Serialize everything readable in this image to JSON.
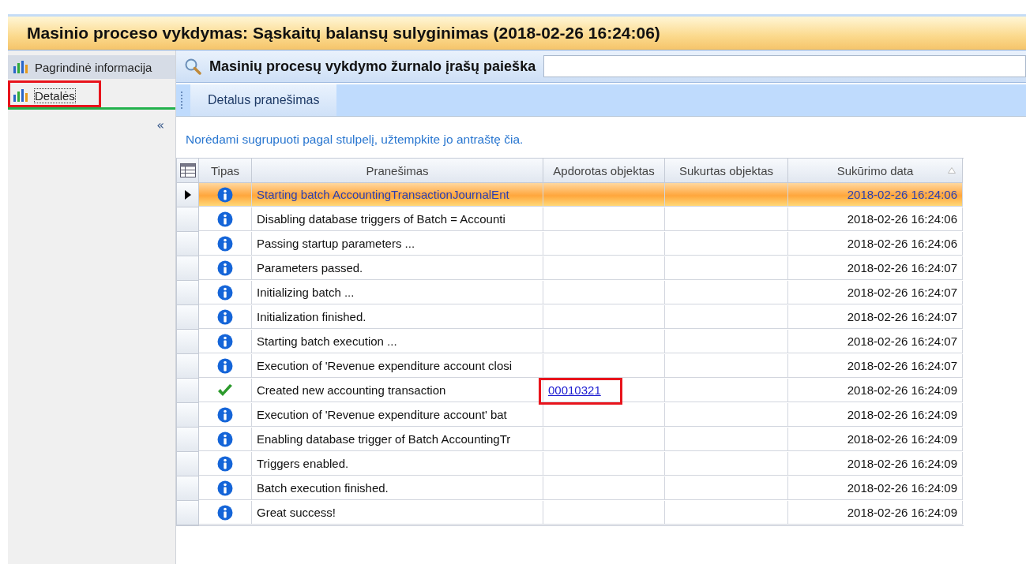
{
  "window": {
    "title": "Masinio proceso vykdymas: Sąskaitų balansų sulyginimas (2018-02-26 16:24:06)"
  },
  "sidebar": {
    "items": [
      {
        "label": "Pagrindinė informacija",
        "selected": false,
        "highlighted": false
      },
      {
        "label": "Detalės",
        "selected": true,
        "highlighted": true
      }
    ],
    "collapse": "«"
  },
  "search": {
    "title": "Masinių procesų vykdymo žurnalo įrašų paieška"
  },
  "toolbar": {
    "buttons": [
      "Detalus pranešimas"
    ]
  },
  "group_hint": "Norėdami sugrupuoti pagal stulpelį, užtempkite jo antraštę čia.",
  "table": {
    "columns": [
      {
        "label": "Tipas",
        "sorted": false
      },
      {
        "label": "Pranešimas",
        "sorted": false
      },
      {
        "label": "Apdorotas objektas",
        "sorted": false
      },
      {
        "label": "Sukurtas objektas",
        "sorted": false
      },
      {
        "label": "Sukūrimo data",
        "sorted": true
      }
    ],
    "rows": [
      {
        "kind": "info",
        "message": "Starting batch AccountingTransactionJournalEnt",
        "date": "2018-02-26 16:24:06",
        "selected": true
      },
      {
        "kind": "info",
        "message": "Disabling database triggers of Batch = Accounti",
        "date": "2018-02-26 16:24:06",
        "selected": false
      },
      {
        "kind": "info",
        "message": "Passing startup parameters ...",
        "date": "2018-02-26 16:24:06",
        "selected": false
      },
      {
        "kind": "info",
        "message": "Parameters passed.",
        "date": "2018-02-26 16:24:07",
        "selected": false
      },
      {
        "kind": "info",
        "message": "Initializing batch ...",
        "date": "2018-02-26 16:24:07",
        "selected": false
      },
      {
        "kind": "info",
        "message": "Initialization finished.",
        "date": "2018-02-26 16:24:07",
        "selected": false
      },
      {
        "kind": "info",
        "message": "Starting batch execution ...",
        "date": "2018-02-26 16:24:07",
        "selected": false
      },
      {
        "kind": "info",
        "message": "Execution of 'Revenue expenditure account closi",
        "date": "2018-02-26 16:24:07",
        "selected": false
      },
      {
        "kind": "success",
        "message": "Created new accounting transaction",
        "processed": "00010321",
        "processed_highlighted": true,
        "date": "2018-02-26 16:24:09",
        "selected": false
      },
      {
        "kind": "info",
        "message": "Execution of 'Revenue expenditure account' bat",
        "date": "2018-02-26 16:24:09",
        "selected": false
      },
      {
        "kind": "info",
        "message": "Enabling database trigger of Batch AccountingTr",
        "date": "2018-02-26 16:24:09",
        "selected": false
      },
      {
        "kind": "info",
        "message": "Triggers enabled.",
        "date": "2018-02-26 16:24:09",
        "selected": false
      },
      {
        "kind": "info",
        "message": "Batch execution finished.",
        "date": "2018-02-26 16:24:09",
        "selected": false
      },
      {
        "kind": "info",
        "message": "Great success!",
        "date": "2018-02-26 16:24:09",
        "selected": false
      }
    ]
  }
}
